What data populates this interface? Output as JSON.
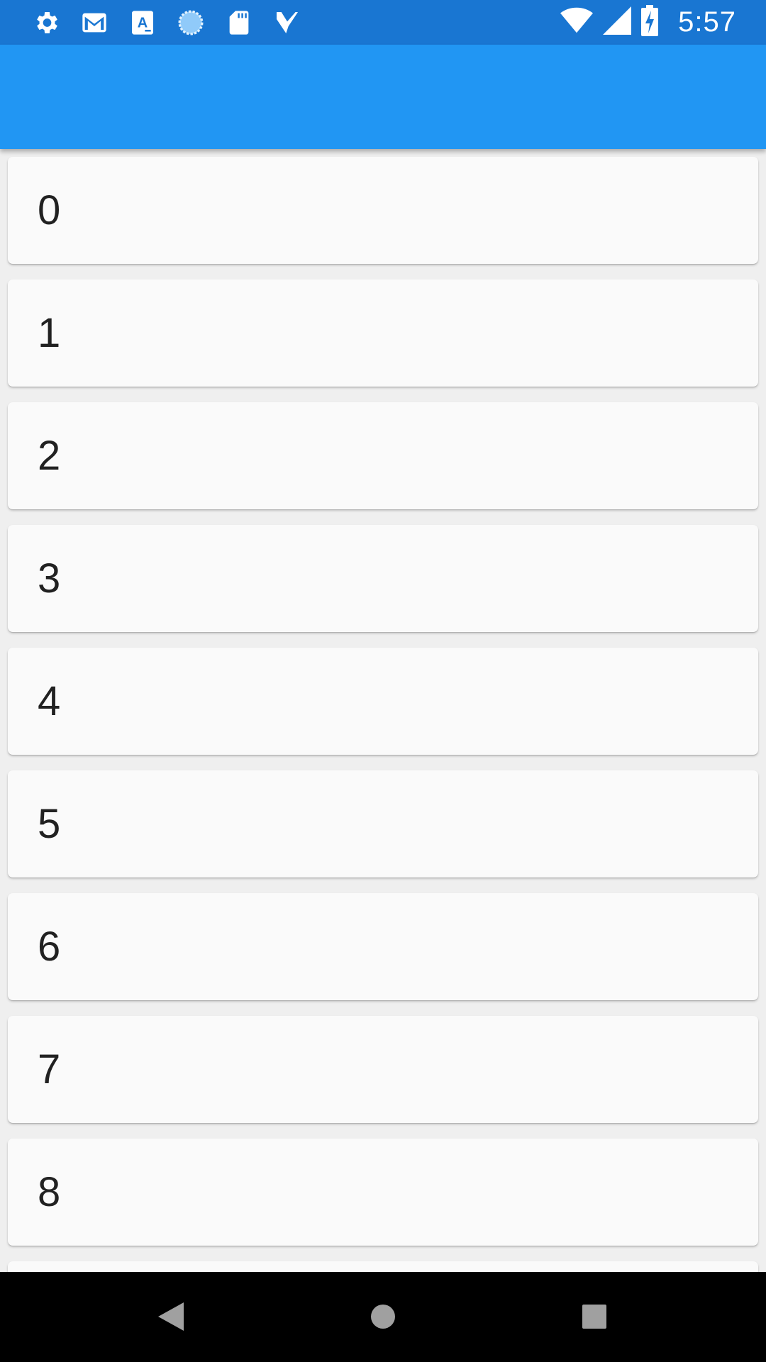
{
  "status_bar": {
    "time": "5:57",
    "background_color": "#1976d2",
    "left_icons": [
      "settings-icon",
      "gmail-icon",
      "text-a-icon",
      "sync-progress-icon",
      "sd-card-icon",
      "checklist-icon"
    ],
    "right_icons": [
      "wifi-icon",
      "cell-signal-icon",
      "battery-charging-icon"
    ]
  },
  "app_bar": {
    "background_color": "#2196f3"
  },
  "list": {
    "items": [
      {
        "label": "0"
      },
      {
        "label": "1"
      },
      {
        "label": "2"
      },
      {
        "label": "3"
      },
      {
        "label": "4"
      },
      {
        "label": "5"
      },
      {
        "label": "6"
      },
      {
        "label": "7"
      },
      {
        "label": "8"
      },
      {
        "label": ""
      }
    ]
  },
  "nav_bar": {
    "buttons": [
      "back-icon",
      "home-icon",
      "recents-icon"
    ]
  }
}
